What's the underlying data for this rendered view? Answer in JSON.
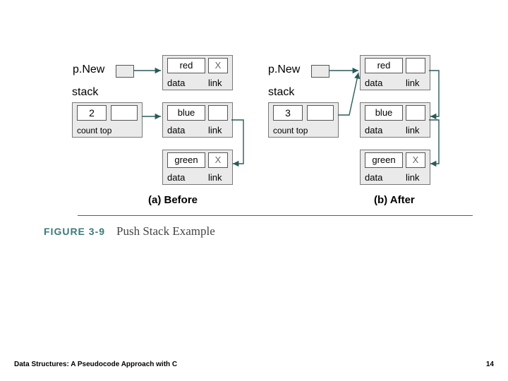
{
  "before_label": "(a) Before",
  "after_label": "(b) After",
  "pnew": "p.New",
  "stack": "stack",
  "fig_label": "FIGURE 3-9",
  "fig_title": "Push Stack Example",
  "footer": "Data Structures: A Pseudocode Approach with C",
  "page": "14",
  "node_data_label": "data",
  "node_link_label": "link",
  "stk_count_label": "count top",
  "before": {
    "count": "2",
    "nodes": [
      {
        "data": "red",
        "link": "X"
      },
      {
        "data": "blue",
        "link": ""
      },
      {
        "data": "green",
        "link": "X"
      }
    ]
  },
  "after": {
    "count": "3",
    "nodes": [
      {
        "data": "red",
        "link": ""
      },
      {
        "data": "blue",
        "link": ""
      },
      {
        "data": "green",
        "link": "X"
      }
    ]
  }
}
